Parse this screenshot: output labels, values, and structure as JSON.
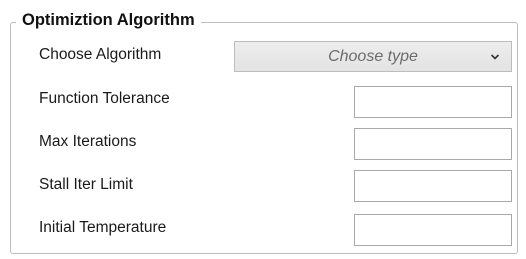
{
  "group": {
    "title": "Optimiztion Algorithm"
  },
  "algorithm": {
    "label": "Choose Algorithm",
    "selected": "Choose type"
  },
  "fields": [
    {
      "label": "Function Tolerance",
      "value": ""
    },
    {
      "label": "Max Iterations",
      "value": ""
    },
    {
      "label": "Stall Iter Limit",
      "value": ""
    },
    {
      "label": "Initial Temperature",
      "value": ""
    }
  ],
  "icons": {
    "dropdown": "chevron-down-icon"
  },
  "colors": {
    "border": "#bdbdbd",
    "combo_bg": "#e8e8e8",
    "placeholder_text": "#6b6b6b"
  }
}
